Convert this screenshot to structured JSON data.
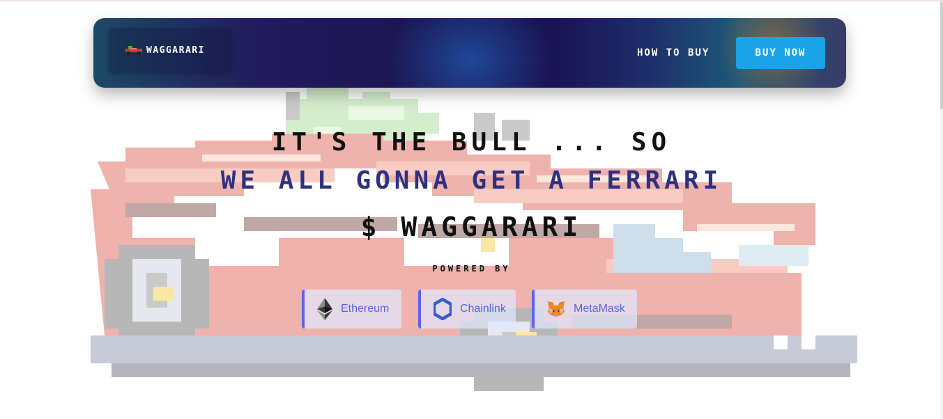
{
  "nav": {
    "brand_label": "WAGGARARI",
    "how_to_buy_label": "HOW TO BUY",
    "buy_now_label": "BUY NOW"
  },
  "hero": {
    "line1": "IT'S THE BULL ... SO",
    "line2": "WE ALL GONNA GET A FERRARI",
    "line3": "$ WAGGARARI",
    "powered_by": "POWERED BY"
  },
  "partners": [
    {
      "label": "Ethereum",
      "icon": "ethereum-icon"
    },
    {
      "label": "Chainlink",
      "icon": "chainlink-icon"
    },
    {
      "label": "MetaMask",
      "icon": "metamask-icon"
    }
  ],
  "colors": {
    "accent": "#1ba3e8",
    "headline_blue": "#2e3182",
    "chip_border": "#5c62f2",
    "chip_text": "#5c62dc"
  }
}
